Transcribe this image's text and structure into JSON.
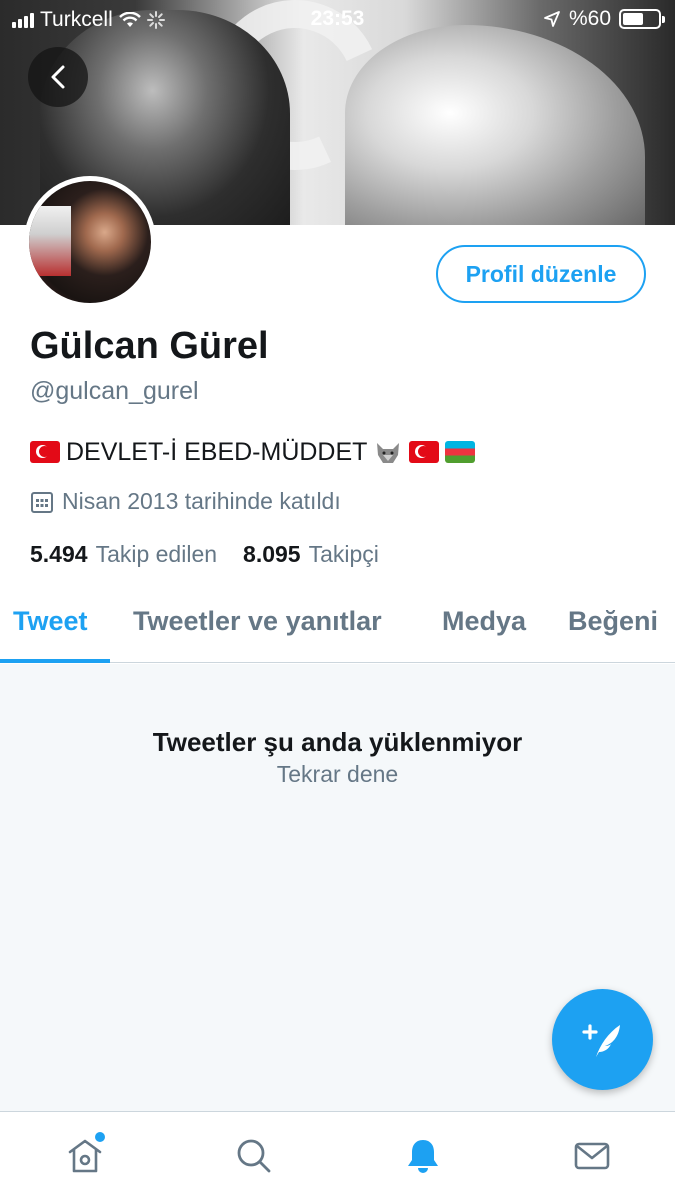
{
  "status_bar": {
    "carrier": "Turkcell",
    "time": "23:53",
    "battery": "%60",
    "battery_level": 0.6
  },
  "profile": {
    "name": "Gülcan Gürel",
    "handle": "@gulcan_gurel",
    "bio_text": "DEVLET-İ EBED-MÜDDET",
    "joined": "Nisan 2013 tarihinde katıldı",
    "edit_button": "Profil düzenle"
  },
  "stats": {
    "following_count": "5.494",
    "following_label": "Takip edilen",
    "followers_count": "8.095",
    "followers_label": "Takipçi"
  },
  "tabs": [
    {
      "label": "Tweet",
      "active": true
    },
    {
      "label": "Tweetler ve yanıtlar",
      "active": false
    },
    {
      "label": "Medya",
      "active": false
    },
    {
      "label": "Beğeni",
      "active": false
    }
  ],
  "content": {
    "message": "Tweetler şu anda yüklenmiyor",
    "retry": "Tekrar dene"
  },
  "bottom_nav": {
    "items": [
      "home-icon",
      "search-icon",
      "notifications-icon",
      "messages-icon"
    ],
    "active": "notifications-icon"
  },
  "colors": {
    "accent": "#1da1f2",
    "text_primary": "#14171a",
    "text_secondary": "#657786",
    "content_bg": "#f5f8fa"
  }
}
